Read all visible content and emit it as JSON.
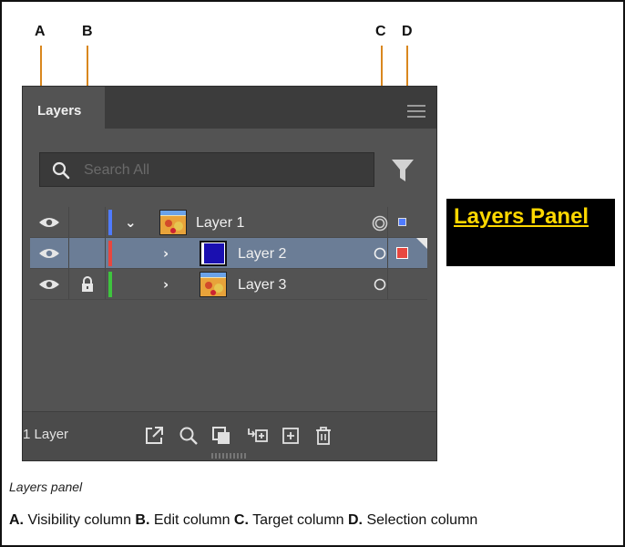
{
  "columns": {
    "a": "A",
    "b": "B",
    "c": "C",
    "d": "D"
  },
  "panel": {
    "tab_label": "Layers",
    "search_placeholder": "Search All",
    "layers": [
      {
        "name": "Layer 1",
        "color": "#4f7bff",
        "expanded": true,
        "visible": true,
        "locked": false
      },
      {
        "name": "Layer 2",
        "color": "#e8473f",
        "expanded": false,
        "visible": true,
        "locked": false
      },
      {
        "name": "Layer 3",
        "color": "#3ec43e",
        "expanded": false,
        "visible": true,
        "locked": true
      }
    ],
    "layer_count": "1 Layer"
  },
  "caption": "Layers panel",
  "legend": {
    "a_key": "A.",
    "a_text": " Visibility column ",
    "b_key": "B.",
    "b_text": " Edit column ",
    "c_key": "C.",
    "c_text": " Target column ",
    "d_key": "D.",
    "d_text": " Selection column"
  },
  "sticker": "Layers Panel",
  "colors": {
    "callout_line": "#d9871e",
    "panel_bg": "#535353",
    "selected_row": "#6b7d96",
    "sticker_text": "#ffd800"
  }
}
